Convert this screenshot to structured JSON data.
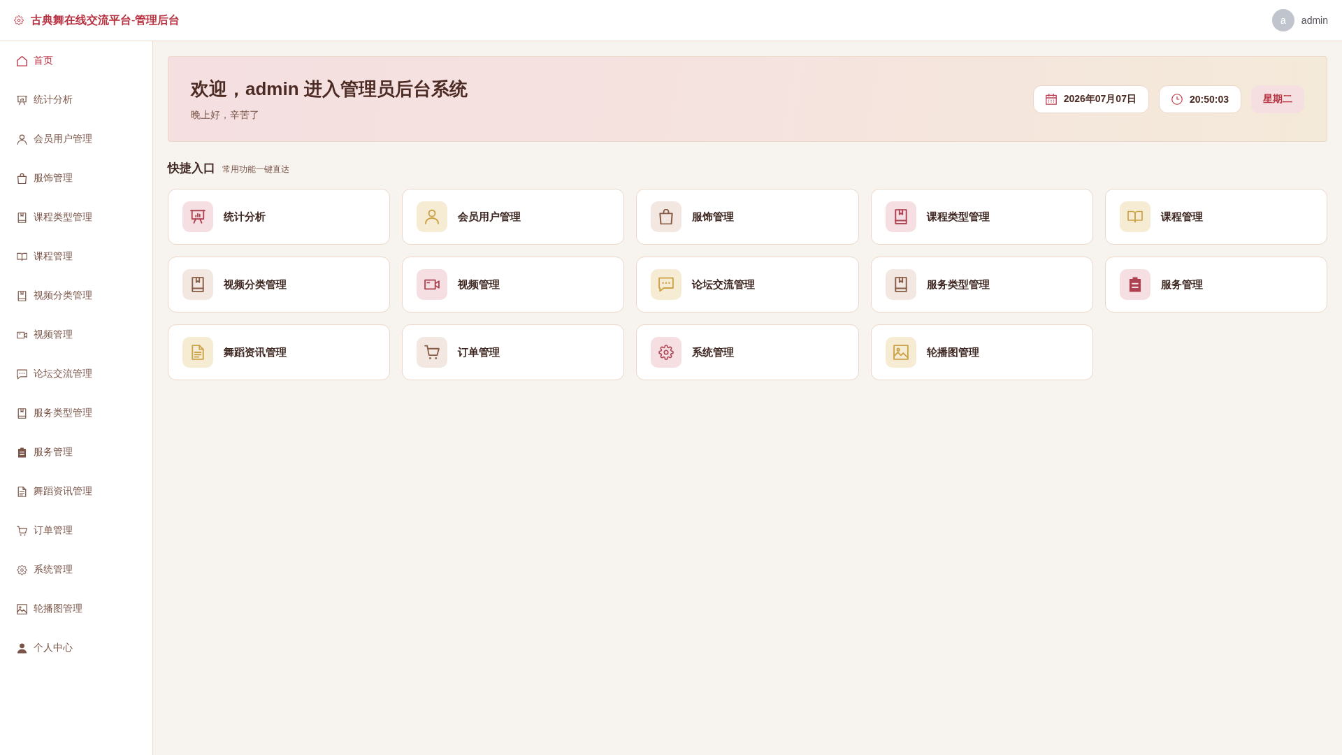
{
  "header": {
    "title": "古典舞在线交流平台-管理后台",
    "user": {
      "avatar_letter": "a",
      "name": "admin"
    }
  },
  "sidebar": {
    "items": [
      {
        "label": "首页",
        "selected": true
      },
      {
        "label": "统计分析",
        "selected": false
      },
      {
        "label": "会员用户管理",
        "selected": false
      },
      {
        "label": "服饰管理",
        "selected": false
      },
      {
        "label": "课程类型管理",
        "selected": false
      },
      {
        "label": "课程管理",
        "selected": false
      },
      {
        "label": "视频分类管理",
        "selected": false
      },
      {
        "label": "视频管理",
        "selected": false
      },
      {
        "label": "论坛交流管理",
        "selected": false
      },
      {
        "label": "服务类型管理",
        "selected": false
      },
      {
        "label": "服务管理",
        "selected": false
      },
      {
        "label": "舞蹈资讯管理",
        "selected": false
      },
      {
        "label": "订单管理",
        "selected": false
      },
      {
        "label": "系统管理",
        "selected": false
      },
      {
        "label": "轮播图管理",
        "selected": false
      },
      {
        "label": "个人中心",
        "selected": false
      }
    ]
  },
  "welcome": {
    "title": "欢迎，admin 进入管理员后台系统",
    "subtitle": "晚上好，辛苦了",
    "date": "2026年07月07日",
    "time": "20:50:03",
    "weekday": "星期二"
  },
  "quick_access": {
    "title": "快捷入口",
    "subtitle": "常用功能一键直达",
    "cards": [
      {
        "label": "统计分析",
        "color": "#f5dfe2"
      },
      {
        "label": "会员用户管理",
        "color": "#f6ebd3"
      },
      {
        "label": "服饰管理",
        "color": "#f2e7e1"
      },
      {
        "label": "课程类型管理",
        "color": "#f5dfe2"
      },
      {
        "label": "课程管理",
        "color": "#f6ebd3"
      },
      {
        "label": "视频分类管理",
        "color": "#f2e7e1"
      },
      {
        "label": "视频管理",
        "color": "#f5dfe2"
      },
      {
        "label": "论坛交流管理",
        "color": "#f6ebd3"
      },
      {
        "label": "服务类型管理",
        "color": "#f2e7e1"
      },
      {
        "label": "服务管理",
        "color": "#f5dfe2"
      },
      {
        "label": "舞蹈资讯管理",
        "color": "#f6ebd3"
      },
      {
        "label": "订单管理",
        "color": "#f2e7e1"
      },
      {
        "label": "系统管理",
        "color": "#f5dfe2"
      },
      {
        "label": "轮播图管理",
        "color": "#f6ebd3"
      }
    ]
  }
}
